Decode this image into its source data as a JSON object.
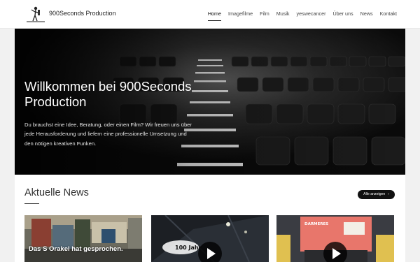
{
  "site": {
    "brand": "900Seconds Production"
  },
  "nav": {
    "items": [
      {
        "label": "Home",
        "active": true
      },
      {
        "label": "Imagefilme"
      },
      {
        "label": "Film"
      },
      {
        "label": "Musik"
      },
      {
        "label": "yeswecancer"
      },
      {
        "label": "Über uns"
      },
      {
        "label": "News"
      },
      {
        "label": "Kontakt"
      }
    ]
  },
  "hero": {
    "title": "Willkommen bei 900Seconds Production",
    "text": "Du brauchst eine Idee, Beratung, oder einen Film? Wir freuen uns über jede Herausforderung und liefern eine professionelle Umsetzung und den nötigen kreativen Funken."
  },
  "news": {
    "heading": "Aktuelle News",
    "all_button": "Alle anzeigen",
    "cards": [
      {
        "caption": "Das S Orakel hat gesprochen."
      },
      {
        "overlay": "100 Jahr"
      },
      {
        "overlay": "DARMERES"
      }
    ]
  },
  "colors": {
    "header_bg": "#ffffff",
    "page_bg": "#f1f1f1",
    "hero_bg": "#0d0d0d",
    "button_bg": "#111111"
  },
  "icons": [
    "logo-figure-icon",
    "play-icon",
    "chevron-right-icon"
  ]
}
